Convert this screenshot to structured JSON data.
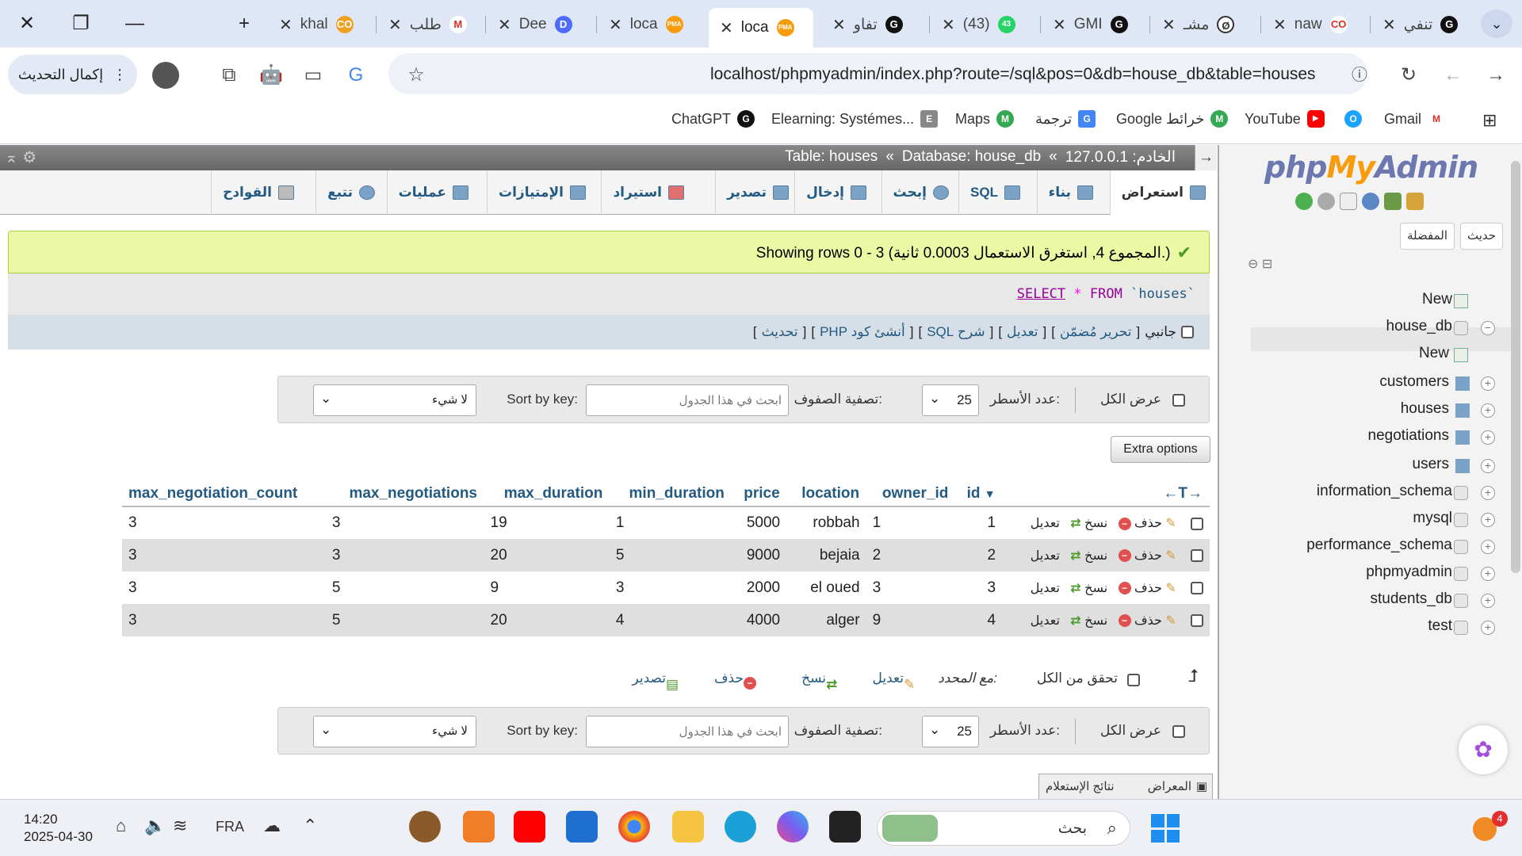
{
  "browser": {
    "tabs": [
      {
        "title": "khal",
        "fav": "CO",
        "color": "#f0a020"
      },
      {
        "title": "طلب",
        "fav": "M",
        "color": "#d93025"
      },
      {
        "title": "Dee",
        "fav": "D",
        "color": "#4d6bfe"
      },
      {
        "title": "loca",
        "fav": "PMA",
        "color": "#f89c0e"
      },
      {
        "title": "loca",
        "fav": "PMA",
        "color": "#f89c0e"
      },
      {
        "title": "تفاو",
        "fav": "G",
        "color": "#111"
      },
      {
        "title": "(43)",
        "fav": "43",
        "color": "#25d366"
      },
      {
        "title": "GMI",
        "fav": "G",
        "color": "#111"
      },
      {
        "title": "مشـ",
        "fav": "Ø",
        "color": "#444"
      },
      {
        "title": "naw",
        "fav": "CO",
        "color": "#d93025"
      },
      {
        "title": "تنفي",
        "fav": "G",
        "color": "#111"
      }
    ],
    "url": "localhost/phpmyadmin/index.php?route=/sql&pos=0&db=house_db&table=houses",
    "update_label": "إكمال التحديث",
    "bookmarks": [
      {
        "label": "ChatGPT",
        "fav": "G",
        "color": "#111"
      },
      {
        "label": "Elearning: Systémes...",
        "fav": "E",
        "color": "#888"
      },
      {
        "label": "Maps",
        "fav": "M",
        "color": "#34a853"
      },
      {
        "label": "ترجمة",
        "fav": "G",
        "color": "#4285f4"
      },
      {
        "label": "Google خرائط",
        "fav": "M",
        "color": "#34a853"
      },
      {
        "label": "YouTube",
        "fav": "▶",
        "color": "#ff0000"
      },
      {
        "label": "",
        "fav": "O",
        "color": "#1aa3ff"
      },
      {
        "label": "Gmail",
        "fav": "M",
        "color": "#d93025"
      }
    ]
  },
  "breadcrumb": {
    "server": "الخادم: 127.0.0.1",
    "database": "Database: house_db",
    "table": "Table: houses",
    "sep": "«"
  },
  "tabs": [
    {
      "label": "استعراض"
    },
    {
      "label": "بناء"
    },
    {
      "label": "SQL"
    },
    {
      "label": "إبحث"
    },
    {
      "label": "إدخال"
    },
    {
      "label": "تصدير"
    },
    {
      "label": "استيراد"
    },
    {
      "label": "الإمتيازات"
    },
    {
      "label": "عمليات"
    },
    {
      "label": "تتبع"
    },
    {
      "label": "القوادح"
    }
  ],
  "message": "Showing rows 0 - 3 (المجموع 4, استغرق الاستعمال 0.0003 ثانية.)",
  "sql": {
    "select": "SELECT",
    "star": "*",
    "from": "FROM",
    "table": "`houses`",
    "tick": "`"
  },
  "sql_links": {
    "inline": "جانبي",
    "profile": "تحرير مُضمّن",
    "edit": "تعديل",
    "explain": "شرح SQL",
    "php": "أنشئ كود PHP",
    "refresh": "تحديث"
  },
  "filter": {
    "show_all": "عرض الكل",
    "rows_label": "عدد الأسطر:",
    "rows_value": "25",
    "filter_label": "تصفية الصفوف:",
    "search_placeholder": "ابحث في هذا الجدول",
    "sort_label": "Sort by key:",
    "sort_value": "لا شيء"
  },
  "extra_options": "Extra options",
  "columns": [
    "id",
    "owner_id",
    "location",
    "price",
    "min_duration",
    "max_duration",
    "max_negotiations",
    "max_negotiation_count"
  ],
  "row_actions": {
    "edit": "تعديل",
    "copy": "نسخ",
    "delete": "حذف"
  },
  "rows": [
    [
      "1",
      "1",
      "robbah",
      "5000",
      "1",
      "19",
      "3",
      "3"
    ],
    [
      "2",
      "2",
      "bejaia",
      "9000",
      "5",
      "20",
      "3",
      "3"
    ],
    [
      "3",
      "3",
      "el oued",
      "2000",
      "3",
      "9",
      "5",
      "3"
    ],
    [
      "4",
      "9",
      "alger",
      "4000",
      "4",
      "20",
      "5",
      "3"
    ]
  ],
  "with_selected": {
    "check_all": "تحقق من الكل",
    "label": "مع المحدد:",
    "edit": "تعديل",
    "copy": "نسخ",
    "delete": "حذف",
    "export": "تصدير"
  },
  "result_tab": "نتائج الإستعلام",
  "result_tab2": "المعراض",
  "sidebar": {
    "recent": "حديث",
    "favorites": "المفضلة",
    "tree": [
      {
        "label": "New"
      },
      {
        "label": "house_db"
      },
      {
        "label": "New"
      },
      {
        "label": "customers"
      },
      {
        "label": "houses"
      },
      {
        "label": "negotiations"
      },
      {
        "label": "users"
      },
      {
        "label": "information_schema"
      },
      {
        "label": "mysql"
      },
      {
        "label": "performance_schema"
      },
      {
        "label": "phpmyadmin"
      },
      {
        "label": "students_db"
      },
      {
        "label": "test"
      }
    ]
  },
  "taskbar": {
    "time": "14:20",
    "date": "2025-04-30",
    "lang": "FRA",
    "search": "بحث",
    "badge": "4"
  }
}
